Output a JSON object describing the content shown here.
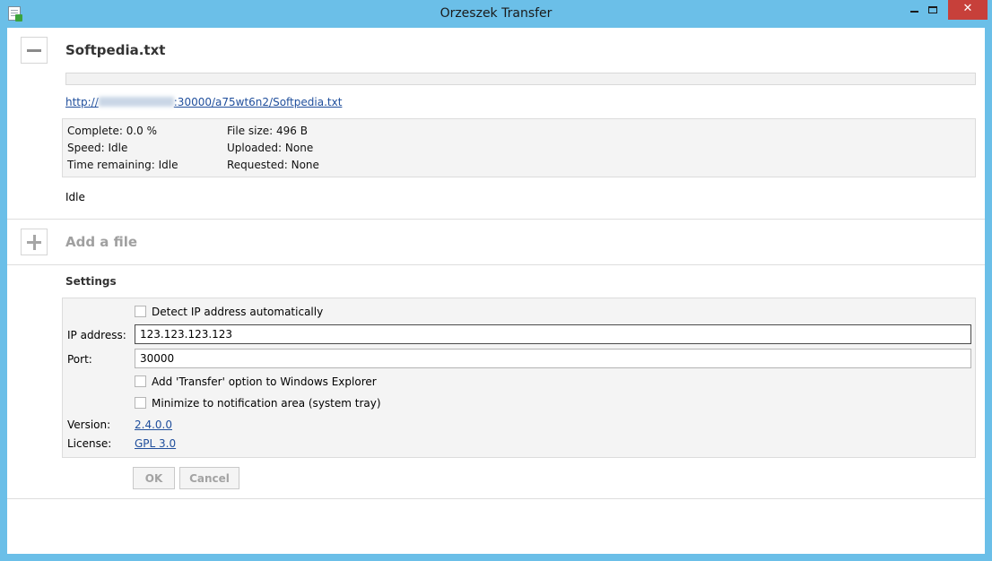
{
  "window": {
    "title": "Orzeszek Transfer",
    "close_glyph": "✕"
  },
  "file": {
    "name": "Softpedia.txt",
    "progress": 0,
    "url_prefix": "http://",
    "url_suffix": ":30000/a75wt6n2/Softpedia.txt",
    "complete": "Complete: 0.0 %",
    "speed": "Speed: Idle",
    "time_remaining": "Time remaining: Idle",
    "file_size": "File size: 496 B",
    "uploaded": "Uploaded: None",
    "requested": "Requested: None",
    "status": "Idle"
  },
  "add": {
    "label": "Add a file"
  },
  "settings": {
    "title": "Settings",
    "detect_ip": "Detect IP address automatically",
    "ip_label": "IP address:",
    "ip_value": "123.123.123.123",
    "port_label": "Port:",
    "port_value": "30000",
    "explorer_option": "Add 'Transfer' option to Windows Explorer",
    "tray_option": "Minimize to notification area (system tray)",
    "version_label": "Version:",
    "version_value": "2.4.0.0",
    "license_label": "License:",
    "license_value": "GPL 3.0"
  },
  "buttons": {
    "ok": "OK",
    "cancel": "Cancel"
  },
  "colors": {
    "titlebar": "#6bbfe8",
    "close": "#c7403a",
    "link": "#1f4e9c"
  }
}
